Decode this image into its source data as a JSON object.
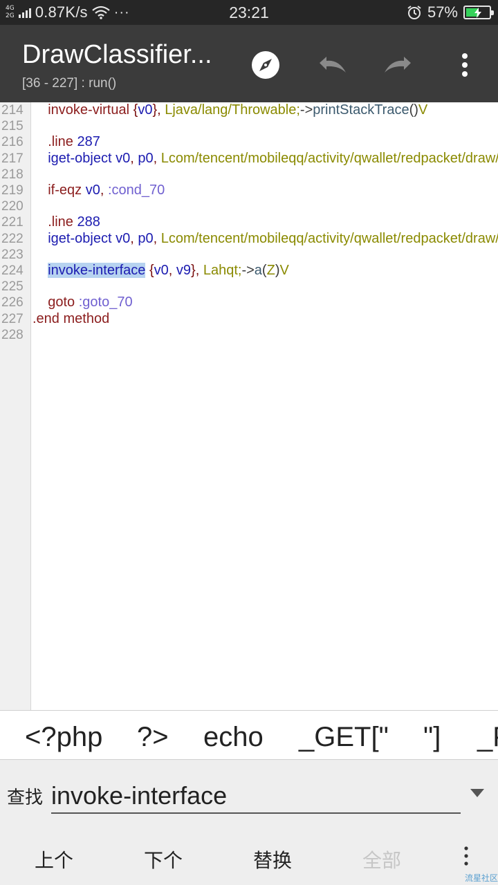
{
  "status_bar": {
    "network_type_top": "4G",
    "network_type_bottom": "2G",
    "speed": "0.87K/s",
    "more_dots": "···",
    "time": "23:21",
    "battery_percent": "57%",
    "battery_level": 57,
    "charging": true
  },
  "toolbar": {
    "title": "DrawClassifier...",
    "subtitle": "[36 - 227] : run()"
  },
  "editor": {
    "highlight_color": "#b7d3f0",
    "lines": [
      {
        "num": "214",
        "tokens": [
          {
            "t": "    "
          },
          {
            "t": "invoke-virtual",
            "c": "op"
          },
          {
            "t": " {"
          },
          {
            "t": "v0",
            "c": "reg"
          },
          {
            "t": "}, "
          },
          {
            "t": "Ljava/lang/Throwable;",
            "c": "typ"
          },
          {
            "t": "->",
            "c": "sym"
          },
          {
            "t": "printStackTrace",
            "c": "meth"
          },
          {
            "t": "()",
            "c": "sym"
          },
          {
            "t": "V",
            "c": "typ"
          }
        ]
      },
      {
        "num": "215",
        "tokens": []
      },
      {
        "num": "216",
        "tokens": [
          {
            "t": "    "
          },
          {
            "t": ".line",
            "c": "op"
          },
          {
            "t": " "
          },
          {
            "t": "287",
            "c": "num"
          }
        ]
      },
      {
        "num": "217",
        "tokens": [
          {
            "t": "    "
          },
          {
            "t": "iget-object",
            "c": "reg"
          },
          {
            "t": " "
          },
          {
            "t": "v0",
            "c": "reg"
          },
          {
            "t": ", "
          },
          {
            "t": "p0",
            "c": "reg"
          },
          {
            "t": ", "
          },
          {
            "t": "Lcom/tencent/mobileqq/activity/qwallet/redpacket/draw/D",
            "c": "typ"
          }
        ]
      },
      {
        "num": "218",
        "tokens": []
      },
      {
        "num": "219",
        "tokens": [
          {
            "t": "    "
          },
          {
            "t": "if-eqz",
            "c": "op"
          },
          {
            "t": " "
          },
          {
            "t": "v0",
            "c": "reg"
          },
          {
            "t": ", "
          },
          {
            "t": ":cond_70",
            "c": "lbl"
          }
        ]
      },
      {
        "num": "220",
        "tokens": []
      },
      {
        "num": "221",
        "tokens": [
          {
            "t": "    "
          },
          {
            "t": ".line",
            "c": "op"
          },
          {
            "t": " "
          },
          {
            "t": "288",
            "c": "num"
          }
        ]
      },
      {
        "num": "222",
        "tokens": [
          {
            "t": "    "
          },
          {
            "t": "iget-object",
            "c": "reg"
          },
          {
            "t": " "
          },
          {
            "t": "v0",
            "c": "reg"
          },
          {
            "t": ", "
          },
          {
            "t": "p0",
            "c": "reg"
          },
          {
            "t": ", "
          },
          {
            "t": "Lcom/tencent/mobileqq/activity/qwallet/redpacket/draw/D",
            "c": "typ"
          }
        ]
      },
      {
        "num": "223",
        "tokens": []
      },
      {
        "num": "224",
        "tokens": [
          {
            "t": "    "
          },
          {
            "t": "invoke-interface",
            "c": "reg hl"
          },
          {
            "t": " {"
          },
          {
            "t": "v0",
            "c": "reg"
          },
          {
            "t": ", "
          },
          {
            "t": "v9",
            "c": "reg"
          },
          {
            "t": "}, "
          },
          {
            "t": "Lahqt;",
            "c": "typ"
          },
          {
            "t": "->",
            "c": "sym"
          },
          {
            "t": "a",
            "c": "meth"
          },
          {
            "t": "(",
            "c": "sym"
          },
          {
            "t": "Z",
            "c": "typ"
          },
          {
            "t": ")",
            "c": "sym"
          },
          {
            "t": "V",
            "c": "typ"
          }
        ]
      },
      {
        "num": "225",
        "tokens": []
      },
      {
        "num": "226",
        "tokens": [
          {
            "t": "    "
          },
          {
            "t": "goto",
            "c": "op"
          },
          {
            "t": " "
          },
          {
            "t": ":goto_70",
            "c": "lbl"
          }
        ]
      },
      {
        "num": "227",
        "tokens": [
          {
            "t": ".end method",
            "c": "op"
          }
        ]
      },
      {
        "num": "228",
        "tokens": []
      }
    ]
  },
  "snippets": [
    "<?php",
    "?>",
    "echo",
    "_GET[\"",
    "\"]",
    "_P"
  ],
  "find": {
    "label": "查找",
    "value": "invoke-interface"
  },
  "actions": {
    "prev": "上个",
    "next": "下个",
    "replace": "替换",
    "all": "全部"
  },
  "watermark": "流星社区"
}
